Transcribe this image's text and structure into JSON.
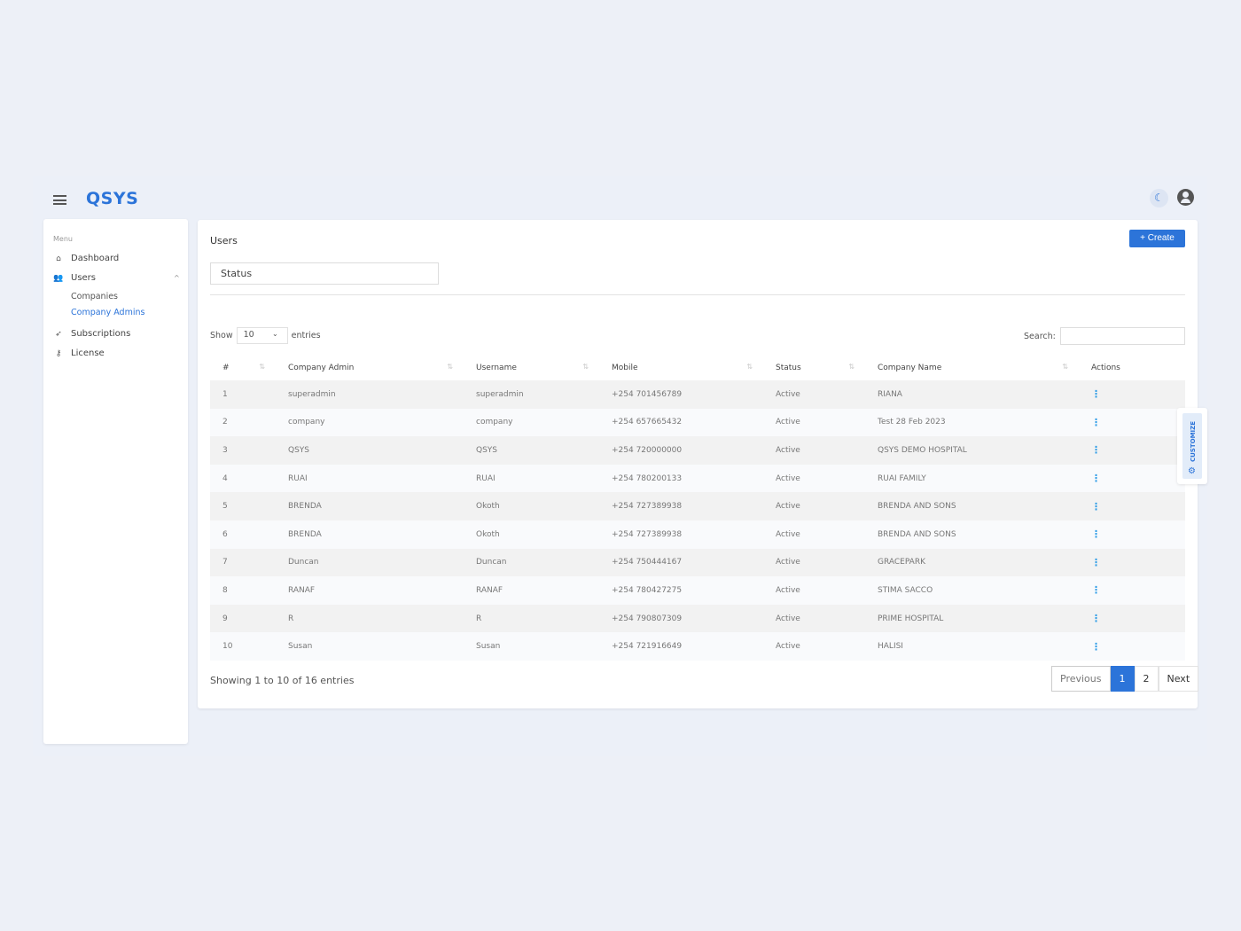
{
  "header": {
    "brand": "QSYS",
    "icons": [
      "hamburger-icon",
      "moon-icon",
      "user-circle-icon"
    ]
  },
  "sidebar": {
    "heading": "Menu",
    "items": [
      {
        "label": "Dashboard",
        "icon": "home-icon"
      },
      {
        "label": "Users",
        "icon": "users-icon",
        "expanded": true,
        "children": [
          {
            "label": "Companies"
          },
          {
            "label": "Company Admins",
            "active": true
          }
        ]
      },
      {
        "label": "Subscriptions",
        "icon": "rocket-icon"
      },
      {
        "label": "License",
        "icon": "key-icon"
      }
    ]
  },
  "main": {
    "title": "Users",
    "create_label": "Create",
    "status_filter": "Status",
    "show_label": "Show",
    "page_size": "10",
    "entries_label": "entries",
    "search_label": "Search:",
    "search_value": "",
    "columns": [
      "#",
      "Company Admin",
      "Username",
      "Mobile",
      "Status",
      "Company Name",
      "Actions"
    ],
    "rows": [
      [
        "1",
        "superadmin",
        "superadmin",
        "+254 701456789",
        "Active",
        "RIANA"
      ],
      [
        "2",
        "company",
        "company",
        "+254 657665432",
        "Active",
        "Test 28 Feb 2023"
      ],
      [
        "3",
        "QSYS",
        "QSYS",
        "+254 720000000",
        "Active",
        "QSYS DEMO HOSPITAL"
      ],
      [
        "4",
        "RUAI",
        "RUAI",
        "+254 780200133",
        "Active",
        "RUAI FAMILY"
      ],
      [
        "5",
        "BRENDA",
        "Okoth",
        "+254 727389938",
        "Active",
        "BRENDA AND SONS"
      ],
      [
        "6",
        "BRENDA",
        "Okoth",
        "+254 727389938",
        "Active",
        "BRENDA AND SONS"
      ],
      [
        "7",
        "Duncan",
        "Duncan",
        "+254 750444167",
        "Active",
        "GRACEPARK"
      ],
      [
        "8",
        "RANAF",
        "RANAF",
        "+254 780427275",
        "Active",
        "STIMA SACCO"
      ],
      [
        "9",
        "R",
        "R",
        "+254 790807309",
        "Active",
        "PRIME HOSPITAL"
      ],
      [
        "10",
        "Susan",
        "Susan",
        "+254 721916649",
        "Active",
        "HALISI"
      ]
    ],
    "info": "Showing 1 to 10 of 16 entries",
    "pagination": {
      "previous": "Previous",
      "pages": [
        "1",
        "2"
      ],
      "current": "1",
      "next": "Next"
    }
  },
  "customize": {
    "label": "CUSTOMIZE"
  },
  "colors": {
    "accent": "#2c74d9",
    "background": "#edf0f7",
    "action_dots": "#2c9be6"
  }
}
